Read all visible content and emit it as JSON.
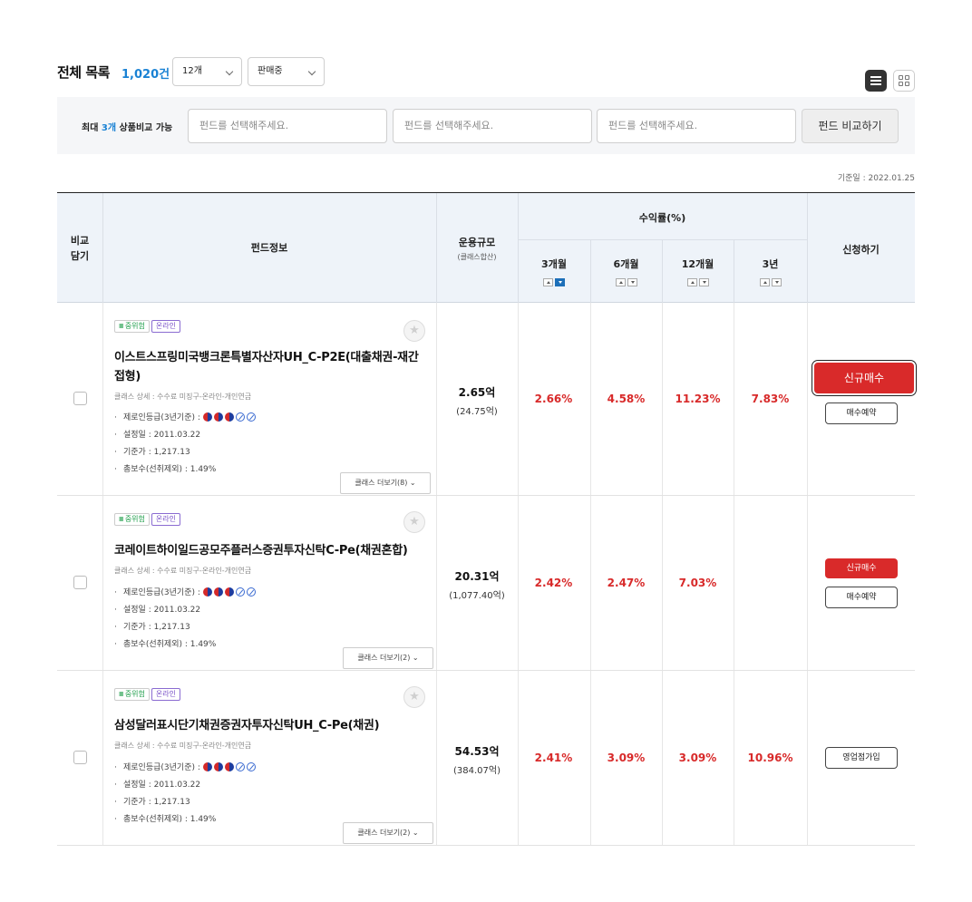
{
  "header": {
    "title": "전체 목록",
    "count": "1,020건",
    "page_size": "12개",
    "status_filter": "판매중"
  },
  "compare": {
    "label_prefix": "최대 ",
    "label_count": "3개",
    "label_suffix": " 상품비교 가능",
    "placeholder": "펀드를 선택해주세요.",
    "button": "펀드 비교하기"
  },
  "base_date": "기준일 : 2022.01.25",
  "table_header": {
    "compare": [
      "비교",
      "담기"
    ],
    "fund_info": "펀드정보",
    "aum": "운용규모",
    "aum_sub": "(클래스합산)",
    "returns": "수익률(%)",
    "periods": [
      "3개월",
      "6개월",
      "12개월",
      "3년"
    ],
    "apply": "신청하기"
  },
  "labels": {
    "risk": "중위험",
    "online": "온라인",
    "zero_grade": "제로인등급(3년기준) :",
    "star_icon": "star-icon",
    "check_icon": "checkbox-icon"
  },
  "funds": [
    {
      "name": "이스트스프링미국뱅크론특별자산자UH_C-P2E(대출채권-재간접형)",
      "class_detail": "클래스 상세 : 수수료 미징구-온라인-개인연금",
      "zero_full": 3,
      "zero_empty": 2,
      "founded": "설정일 : 2011.03.22",
      "base_price": "기준가 : 1,217.13",
      "fee": "총보수(선취제외) : 1.49%",
      "more": "클래스 더보기(8) ⌄",
      "aum": "2.65억",
      "aum_sub": "(24.75억)",
      "returns": [
        "2.66%",
        "4.58%",
        "11.23%",
        "7.83%"
      ],
      "primary_button": "신규매수",
      "secondary_button": "매수예약"
    },
    {
      "name": "코레이트하이일드공모주플러스증권투자신탁C-Pe(채권혼합)",
      "class_detail": "클래스 상세 : 수수료 미징구-온라인-개인연금",
      "zero_full": 3,
      "zero_empty": 2,
      "founded": "설정일 : 2011.03.22",
      "base_price": "기준가 : 1,217.13",
      "fee": "총보수(선취제외) : 1.49%",
      "more": "클래스 더보기(2) ⌄",
      "aum": "20.31억",
      "aum_sub": "(1,077.40억)",
      "returns": [
        "2.42%",
        "2.47%",
        "7.03%",
        ""
      ],
      "primary_button": "신규매수",
      "secondary_button": "매수예약"
    },
    {
      "name": "삼성달러표시단기채권증권자투자신탁UH_C-Pe(채권)",
      "class_detail": "클래스 상세 : 수수료 미징구-온라인-개인연금",
      "zero_full": 3,
      "zero_empty": 2,
      "founded": "설정일 : 2011.03.22",
      "base_price": "기준가 : 1,217.13",
      "fee": "총보수(선취제외) : 1.49%",
      "more": "클래스 더보기(2) ⌄",
      "aum": "54.53억",
      "aum_sub": "(384.07억)",
      "returns": [
        "2.41%",
        "3.09%",
        "3.09%",
        "10.96%"
      ],
      "secondary_button": "영업점가입"
    }
  ]
}
